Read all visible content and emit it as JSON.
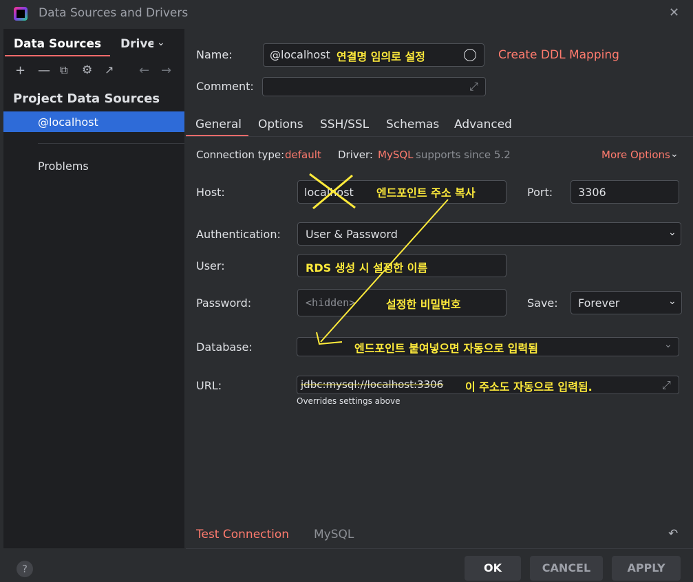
{
  "window": {
    "title": "Data Sources and Drivers",
    "close_icon": "close-icon"
  },
  "left_panel": {
    "tabs": [
      {
        "label": "Data Sources"
      },
      {
        "label": "Drivers"
      }
    ],
    "toolbar_icons": [
      "plus-icon",
      "minus-icon",
      "copy-icon",
      "gear-icon",
      "open-external-icon",
      "back-arrow-icon",
      "forward-arrow-icon"
    ],
    "section_title": "Project Data Sources",
    "items": [
      {
        "label": "@localhost"
      }
    ],
    "problems_label": "Problems",
    "help_label": "?"
  },
  "form": {
    "name_label": "Name:",
    "name_value": "@localhost",
    "name_annotation": "연결명 임의로 설정",
    "create_ddl": "Create DDL Mapping",
    "comment_label": "Comment:",
    "tabs": [
      {
        "label": "General"
      },
      {
        "label": "Options"
      },
      {
        "label": "SSH/SSL"
      },
      {
        "label": "Schemas"
      },
      {
        "label": "Advanced"
      }
    ],
    "connection_type_label": "Connection type:",
    "connection_type_value": "default",
    "driver_label": "Driver:",
    "driver_value": "MySQL",
    "driver_note": "supports since 5.2",
    "more_options": "More Options",
    "host_label": "Host:",
    "host_value": "localhost",
    "host_annotation": "엔드포인트 주소 복사",
    "port_label": "Port:",
    "port_value": "3306",
    "auth_label": "Authentication:",
    "auth_value": "User & Password",
    "user_label": "User:",
    "user_annotation": "RDS 생성 시 설정한 이름",
    "password_label": "Password:",
    "password_placeholder": "<hidden>",
    "password_annotation": "설정한 비밀번호",
    "save_label": "Save:",
    "save_value": "Forever",
    "database_label": "Database:",
    "database_annotation": "엔드포인트 붙여넣으면 자동으로 입력됨",
    "url_label": "URL:",
    "url_value": "jdbc:mysql://localhost:3306",
    "url_annotation": "이 주소도 자동으로 입력됨.",
    "url_hint": "Overrides settings above",
    "test_connection": "Test Connection",
    "driver_footer": "MySQL"
  },
  "buttons": {
    "ok": "OK",
    "cancel": "CANCEL",
    "apply": "APPLY"
  },
  "colors": {
    "accent": "#ff7b6e",
    "selection": "#2e6bd8",
    "annotation": "#ffeb3b"
  }
}
